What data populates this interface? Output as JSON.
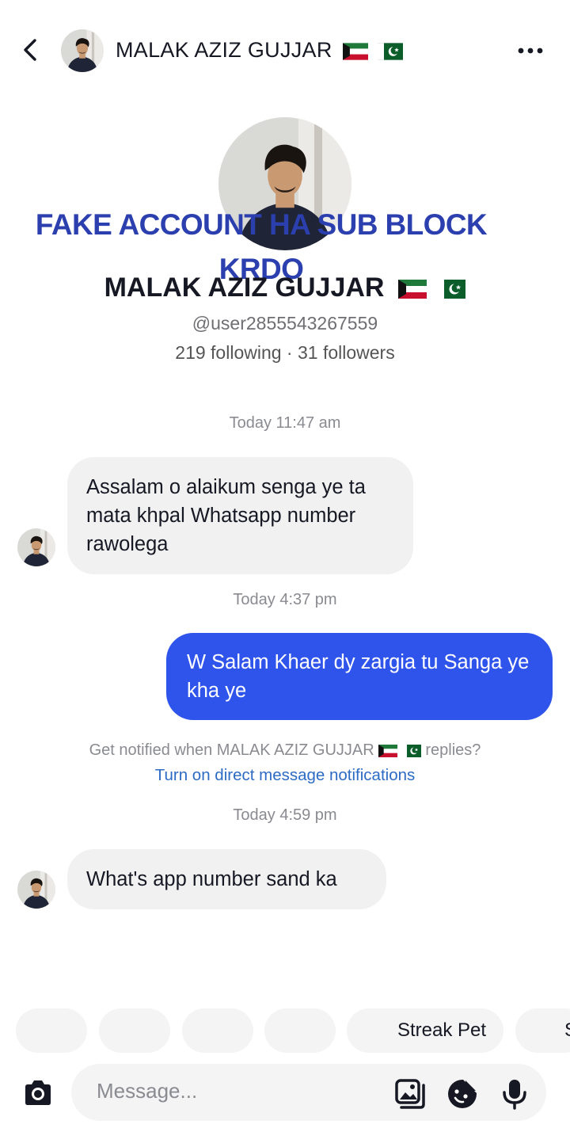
{
  "header": {
    "contact_name": "MALAK AZIZ GUJJAR",
    "back_icon": "chevron-left-icon",
    "more_icon": "more-horizontal-icon"
  },
  "profile": {
    "overlay_text": "FAKE ACCOUNT HA SUB BLOCK KRDO",
    "name": "MALAK AZIZ GUJJAR",
    "username": "@user2855543267559",
    "stats": "219 following · 31 followers"
  },
  "messages": [
    {
      "timestamp": "Today 11:47 am",
      "direction": "incoming",
      "text": "Assalam o alaikum senga ye ta mata khpal Whatsapp number rawolega"
    },
    {
      "timestamp": "Today 4:37 pm",
      "direction": "outgoing",
      "text": "W Salam Khaer dy zargia tu Sanga ye kha ye"
    },
    {
      "timestamp": "Today 4:59 pm",
      "direction": "incoming",
      "text": "What's app number sand ka"
    }
  ],
  "notification": {
    "prompt_prefix": "Get notified when MALAK AZIZ GUJJAR",
    "prompt_suffix": "replies?",
    "link": "Turn on direct message notifications"
  },
  "quick_replies": {
    "streak_pet": "Streak Pet",
    "partial": "S"
  },
  "composer": {
    "placeholder": "Message...",
    "icons": [
      "camera-icon",
      "image-icon",
      "sticker-icon",
      "microphone-icon"
    ]
  },
  "colors": {
    "outgoing_bubble": "#2f54eb",
    "incoming_bubble": "#f1f1f2",
    "overlay_text": "#2b3fae",
    "link": "#2d6bc4"
  }
}
